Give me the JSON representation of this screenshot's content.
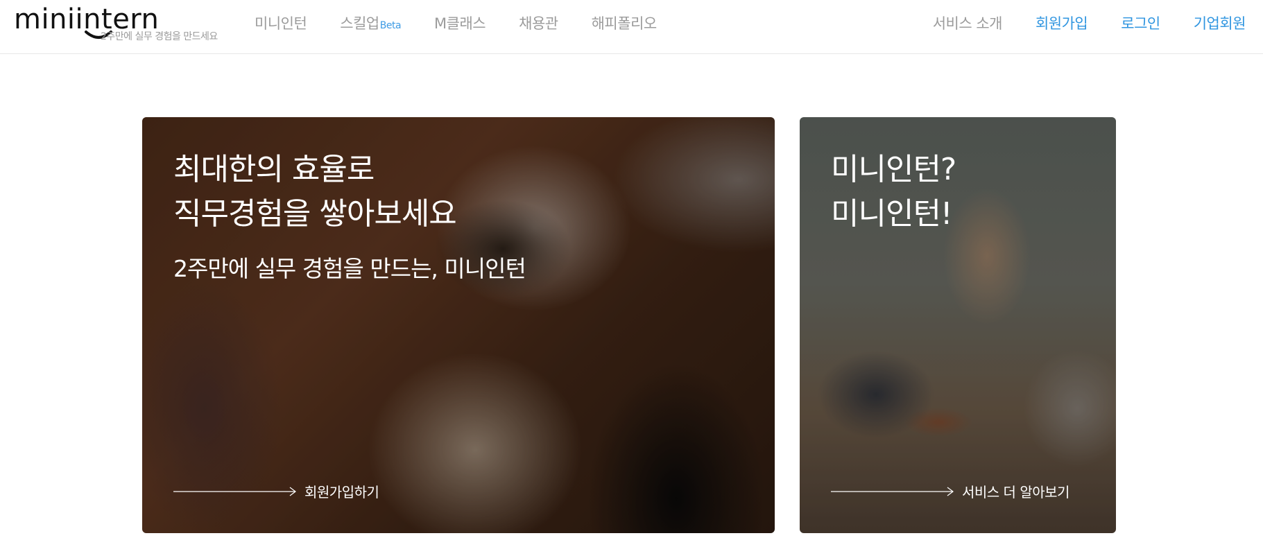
{
  "header": {
    "logo_text": "miniintern",
    "tagline": "2주만에 실무 경험을 만드세요",
    "nav": [
      {
        "label": "미니인턴",
        "badge": ""
      },
      {
        "label": "스킬업",
        "badge": "Beta"
      },
      {
        "label": "M클래스",
        "badge": ""
      },
      {
        "label": "채용관",
        "badge": ""
      },
      {
        "label": "해피폴리오",
        "badge": ""
      }
    ],
    "right_nav": [
      {
        "label": "서비스 소개",
        "style": "muted"
      },
      {
        "label": "회원가입",
        "style": "accent"
      },
      {
        "label": "로그인",
        "style": "accent"
      },
      {
        "label": "기업회원",
        "style": "accent"
      }
    ]
  },
  "hero_left": {
    "headline_line1": "최대한의 효율로",
    "headline_line2": "직무경험을 쌓아보세요",
    "subtitle": "2주만에 실무 경험을 만드는, 미니인턴",
    "cta_label": "회원가입하기"
  },
  "hero_right": {
    "headline_line1": "미니인턴?",
    "headline_line2": "미니인턴!",
    "cta_label": "서비스 더 알아보기"
  },
  "colors": {
    "accent": "#2f95e0",
    "nav_muted": "#9b9b9b",
    "beta": "#3e9be4"
  }
}
